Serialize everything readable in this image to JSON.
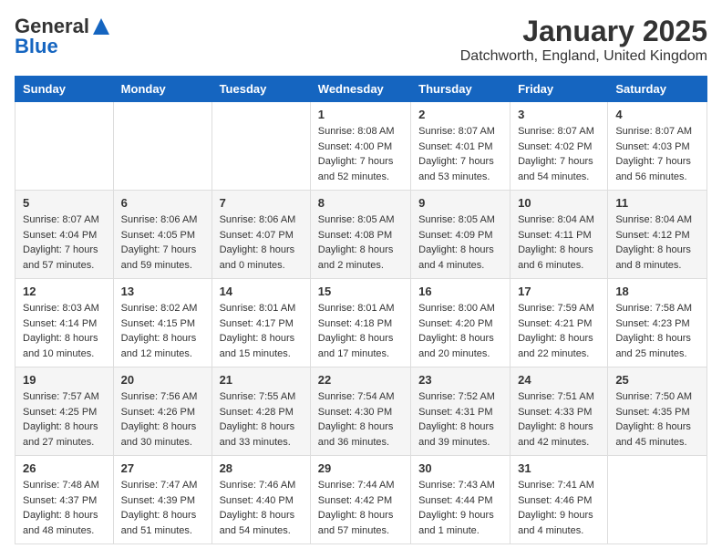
{
  "logo": {
    "general": "General",
    "blue": "Blue"
  },
  "header": {
    "month": "January 2025",
    "location": "Datchworth, England, United Kingdom"
  },
  "weekdays": [
    "Sunday",
    "Monday",
    "Tuesday",
    "Wednesday",
    "Thursday",
    "Friday",
    "Saturday"
  ],
  "weeks": [
    [
      {
        "day": "",
        "sunrise": "",
        "sunset": "",
        "daylight": ""
      },
      {
        "day": "",
        "sunrise": "",
        "sunset": "",
        "daylight": ""
      },
      {
        "day": "",
        "sunrise": "",
        "sunset": "",
        "daylight": ""
      },
      {
        "day": "1",
        "sunrise": "Sunrise: 8:08 AM",
        "sunset": "Sunset: 4:00 PM",
        "daylight": "Daylight: 7 hours and 52 minutes."
      },
      {
        "day": "2",
        "sunrise": "Sunrise: 8:07 AM",
        "sunset": "Sunset: 4:01 PM",
        "daylight": "Daylight: 7 hours and 53 minutes."
      },
      {
        "day": "3",
        "sunrise": "Sunrise: 8:07 AM",
        "sunset": "Sunset: 4:02 PM",
        "daylight": "Daylight: 7 hours and 54 minutes."
      },
      {
        "day": "4",
        "sunrise": "Sunrise: 8:07 AM",
        "sunset": "Sunset: 4:03 PM",
        "daylight": "Daylight: 7 hours and 56 minutes."
      }
    ],
    [
      {
        "day": "5",
        "sunrise": "Sunrise: 8:07 AM",
        "sunset": "Sunset: 4:04 PM",
        "daylight": "Daylight: 7 hours and 57 minutes."
      },
      {
        "day": "6",
        "sunrise": "Sunrise: 8:06 AM",
        "sunset": "Sunset: 4:05 PM",
        "daylight": "Daylight: 7 hours and 59 minutes."
      },
      {
        "day": "7",
        "sunrise": "Sunrise: 8:06 AM",
        "sunset": "Sunset: 4:07 PM",
        "daylight": "Daylight: 8 hours and 0 minutes."
      },
      {
        "day": "8",
        "sunrise": "Sunrise: 8:05 AM",
        "sunset": "Sunset: 4:08 PM",
        "daylight": "Daylight: 8 hours and 2 minutes."
      },
      {
        "day": "9",
        "sunrise": "Sunrise: 8:05 AM",
        "sunset": "Sunset: 4:09 PM",
        "daylight": "Daylight: 8 hours and 4 minutes."
      },
      {
        "day": "10",
        "sunrise": "Sunrise: 8:04 AM",
        "sunset": "Sunset: 4:11 PM",
        "daylight": "Daylight: 8 hours and 6 minutes."
      },
      {
        "day": "11",
        "sunrise": "Sunrise: 8:04 AM",
        "sunset": "Sunset: 4:12 PM",
        "daylight": "Daylight: 8 hours and 8 minutes."
      }
    ],
    [
      {
        "day": "12",
        "sunrise": "Sunrise: 8:03 AM",
        "sunset": "Sunset: 4:14 PM",
        "daylight": "Daylight: 8 hours and 10 minutes."
      },
      {
        "day": "13",
        "sunrise": "Sunrise: 8:02 AM",
        "sunset": "Sunset: 4:15 PM",
        "daylight": "Daylight: 8 hours and 12 minutes."
      },
      {
        "day": "14",
        "sunrise": "Sunrise: 8:01 AM",
        "sunset": "Sunset: 4:17 PM",
        "daylight": "Daylight: 8 hours and 15 minutes."
      },
      {
        "day": "15",
        "sunrise": "Sunrise: 8:01 AM",
        "sunset": "Sunset: 4:18 PM",
        "daylight": "Daylight: 8 hours and 17 minutes."
      },
      {
        "day": "16",
        "sunrise": "Sunrise: 8:00 AM",
        "sunset": "Sunset: 4:20 PM",
        "daylight": "Daylight: 8 hours and 20 minutes."
      },
      {
        "day": "17",
        "sunrise": "Sunrise: 7:59 AM",
        "sunset": "Sunset: 4:21 PM",
        "daylight": "Daylight: 8 hours and 22 minutes."
      },
      {
        "day": "18",
        "sunrise": "Sunrise: 7:58 AM",
        "sunset": "Sunset: 4:23 PM",
        "daylight": "Daylight: 8 hours and 25 minutes."
      }
    ],
    [
      {
        "day": "19",
        "sunrise": "Sunrise: 7:57 AM",
        "sunset": "Sunset: 4:25 PM",
        "daylight": "Daylight: 8 hours and 27 minutes."
      },
      {
        "day": "20",
        "sunrise": "Sunrise: 7:56 AM",
        "sunset": "Sunset: 4:26 PM",
        "daylight": "Daylight: 8 hours and 30 minutes."
      },
      {
        "day": "21",
        "sunrise": "Sunrise: 7:55 AM",
        "sunset": "Sunset: 4:28 PM",
        "daylight": "Daylight: 8 hours and 33 minutes."
      },
      {
        "day": "22",
        "sunrise": "Sunrise: 7:54 AM",
        "sunset": "Sunset: 4:30 PM",
        "daylight": "Daylight: 8 hours and 36 minutes."
      },
      {
        "day": "23",
        "sunrise": "Sunrise: 7:52 AM",
        "sunset": "Sunset: 4:31 PM",
        "daylight": "Daylight: 8 hours and 39 minutes."
      },
      {
        "day": "24",
        "sunrise": "Sunrise: 7:51 AM",
        "sunset": "Sunset: 4:33 PM",
        "daylight": "Daylight: 8 hours and 42 minutes."
      },
      {
        "day": "25",
        "sunrise": "Sunrise: 7:50 AM",
        "sunset": "Sunset: 4:35 PM",
        "daylight": "Daylight: 8 hours and 45 minutes."
      }
    ],
    [
      {
        "day": "26",
        "sunrise": "Sunrise: 7:48 AM",
        "sunset": "Sunset: 4:37 PM",
        "daylight": "Daylight: 8 hours and 48 minutes."
      },
      {
        "day": "27",
        "sunrise": "Sunrise: 7:47 AM",
        "sunset": "Sunset: 4:39 PM",
        "daylight": "Daylight: 8 hours and 51 minutes."
      },
      {
        "day": "28",
        "sunrise": "Sunrise: 7:46 AM",
        "sunset": "Sunset: 4:40 PM",
        "daylight": "Daylight: 8 hours and 54 minutes."
      },
      {
        "day": "29",
        "sunrise": "Sunrise: 7:44 AM",
        "sunset": "Sunset: 4:42 PM",
        "daylight": "Daylight: 8 hours and 57 minutes."
      },
      {
        "day": "30",
        "sunrise": "Sunrise: 7:43 AM",
        "sunset": "Sunset: 4:44 PM",
        "daylight": "Daylight: 9 hours and 1 minute."
      },
      {
        "day": "31",
        "sunrise": "Sunrise: 7:41 AM",
        "sunset": "Sunset: 4:46 PM",
        "daylight": "Daylight: 9 hours and 4 minutes."
      },
      {
        "day": "",
        "sunrise": "",
        "sunset": "",
        "daylight": ""
      }
    ]
  ]
}
